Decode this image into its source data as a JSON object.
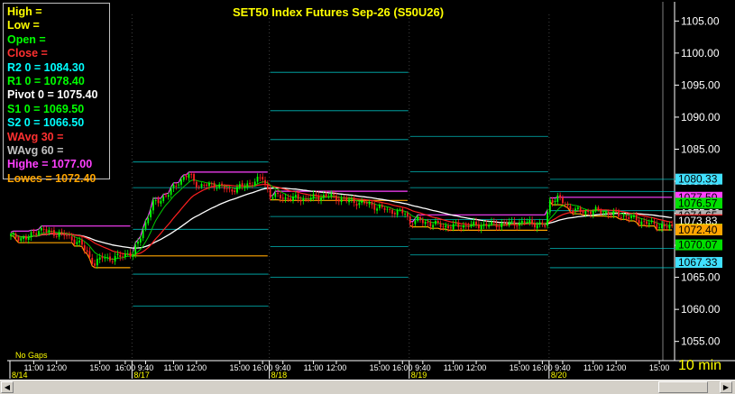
{
  "chart_data": {
    "type": "candlestick",
    "title": "SET50  Index  Futures  Sep-26  (S50U26)",
    "interval_label": "10  min",
    "no_gaps_label": "No  Gaps",
    "ylim": [
      1052,
      1108
    ],
    "y_ticks": [
      {
        "value": 1055,
        "label": "1055.00"
      },
      {
        "value": 1060,
        "label": "1060.00"
      },
      {
        "value": 1065,
        "label": "1065.00"
      },
      {
        "value": 1070,
        "label": "1070.00"
      },
      {
        "value": 1075,
        "label": "1075.00"
      },
      {
        "value": 1080,
        "label": "1080.00"
      },
      {
        "value": 1085,
        "label": "1085.00"
      },
      {
        "value": 1090,
        "label": "1090.00"
      },
      {
        "value": 1095,
        "label": "1095.00"
      },
      {
        "value": 1100,
        "label": "1100.00"
      },
      {
        "value": 1105,
        "label": "1105.00"
      }
    ],
    "x_time_labels": [
      {
        "i": 9,
        "label": "11:00"
      },
      {
        "i": 18,
        "label": "12:00"
      },
      {
        "i": 35,
        "label": "15:00"
      },
      {
        "i": 45,
        "label": "16:00"
      },
      {
        "i": 53,
        "label": "9:40"
      },
      {
        "i": 64,
        "label": "11:00"
      },
      {
        "i": 73,
        "label": "12:00"
      },
      {
        "i": 90,
        "label": "15:00"
      },
      {
        "i": 99,
        "label": "16:00"
      },
      {
        "i": 107,
        "label": "9:40"
      },
      {
        "i": 119,
        "label": "11:00"
      },
      {
        "i": 128,
        "label": "12:00"
      },
      {
        "i": 145,
        "label": "15:00"
      },
      {
        "i": 154,
        "label": "16:00"
      },
      {
        "i": 162,
        "label": "9:40"
      },
      {
        "i": 174,
        "label": "11:00"
      },
      {
        "i": 183,
        "label": "12:00"
      },
      {
        "i": 200,
        "label": "15:00"
      },
      {
        "i": 209,
        "label": "16:00"
      },
      {
        "i": 217,
        "label": "9:40"
      },
      {
        "i": 229,
        "label": "11:00"
      },
      {
        "i": 238,
        "label": "12:00"
      },
      {
        "i": 255,
        "label": "15:00"
      }
    ],
    "x_date_labels": [
      {
        "i": 0,
        "label": "8/14"
      },
      {
        "i": 48,
        "label": "8/17"
      },
      {
        "i": 102,
        "label": "8/18"
      },
      {
        "i": 157,
        "label": "8/19"
      },
      {
        "i": 212,
        "label": "8/20"
      }
    ],
    "day_starts": [
      48,
      102,
      157,
      212
    ],
    "anchors": [
      {
        "i": 0,
        "v": 1071.5
      },
      {
        "i": 6,
        "v": 1071.0
      },
      {
        "i": 11,
        "v": 1072.5
      },
      {
        "i": 16,
        "v": 1072.0
      },
      {
        "i": 22,
        "v": 1071.5
      },
      {
        "i": 28,
        "v": 1070.0
      },
      {
        "i": 33,
        "v": 1067.0
      },
      {
        "i": 36,
        "v": 1068.2
      },
      {
        "i": 40,
        "v": 1067.8
      },
      {
        "i": 46,
        "v": 1068.8
      },
      {
        "i": 48,
        "v": 1068.5
      },
      {
        "i": 52,
        "v": 1072.5
      },
      {
        "i": 56,
        "v": 1076.5
      },
      {
        "i": 62,
        "v": 1078.0
      },
      {
        "i": 66,
        "v": 1080.0
      },
      {
        "i": 70,
        "v": 1081.0
      },
      {
        "i": 74,
        "v": 1079.2
      },
      {
        "i": 80,
        "v": 1079.5
      },
      {
        "i": 86,
        "v": 1078.6
      },
      {
        "i": 92,
        "v": 1079.3
      },
      {
        "i": 99,
        "v": 1080.5
      },
      {
        "i": 102,
        "v": 1077.8
      },
      {
        "i": 108,
        "v": 1077.4
      },
      {
        "i": 116,
        "v": 1077.2
      },
      {
        "i": 124,
        "v": 1077.8
      },
      {
        "i": 132,
        "v": 1077.0
      },
      {
        "i": 140,
        "v": 1076.5
      },
      {
        "i": 148,
        "v": 1075.5
      },
      {
        "i": 155,
        "v": 1075.0
      },
      {
        "i": 157,
        "v": 1073.6
      },
      {
        "i": 160,
        "v": 1073.9
      },
      {
        "i": 165,
        "v": 1073.4
      },
      {
        "i": 172,
        "v": 1072.9
      },
      {
        "i": 180,
        "v": 1073.1
      },
      {
        "i": 188,
        "v": 1073.2
      },
      {
        "i": 196,
        "v": 1073.4
      },
      {
        "i": 204,
        "v": 1073.6
      },
      {
        "i": 210,
        "v": 1073.0
      },
      {
        "i": 212,
        "v": 1077.0
      },
      {
        "i": 215,
        "v": 1077.4
      },
      {
        "i": 219,
        "v": 1076.0
      },
      {
        "i": 224,
        "v": 1075.2
      },
      {
        "i": 230,
        "v": 1075.4
      },
      {
        "i": 236,
        "v": 1075.0
      },
      {
        "i": 242,
        "v": 1074.5
      },
      {
        "i": 250,
        "v": 1073.5
      },
      {
        "i": 256,
        "v": 1073.0
      },
      {
        "i": 260,
        "v": 1072.7
      }
    ],
    "day_high_low": [
      {
        "from": 0,
        "to": 48,
        "high": 1074.0,
        "low": 1066.5
      },
      {
        "from": 48,
        "to": 102,
        "high": 1081.6,
        "low": 1066.5
      },
      {
        "from": 102,
        "to": 157,
        "high": 1081.6,
        "low": 1077.0
      },
      {
        "from": 157,
        "to": 212,
        "high": 1078.2,
        "low": 1071.0
      },
      {
        "from": 212,
        "to": 262,
        "high": 1077.5,
        "low": 1072.4
      }
    ],
    "pivot_segments": [
      {
        "from": 48,
        "to": 102,
        "levels": [
          1083.0,
          1079.0,
          1072.5,
          1065.5,
          1060.5
        ]
      },
      {
        "from": 102,
        "to": 157,
        "levels": [
          1097.0,
          1091.0,
          1086.5,
          1080.0,
          1074.5,
          1069.8,
          1065.0
        ]
      },
      {
        "from": 157,
        "to": 212,
        "levels": [
          1087.0,
          1081.5,
          1079.0,
          1074.0,
          1071.0,
          1068.5
        ]
      },
      {
        "from": 212,
        "to": 262,
        "levels": [
          1080.3,
          1078.4,
          1075.4,
          1069.5,
          1066.5
        ]
      }
    ],
    "legend": [
      {
        "label": "High  =",
        "color": "#ffff00"
      },
      {
        "label": "Low  =",
        "color": "#ffff00"
      },
      {
        "label": "Open  =",
        "color": "#00ff00"
      },
      {
        "label": "Close  =",
        "color": "#ff3030"
      },
      {
        "label": "R2  0   = 1084.30",
        "color": "#00ffff"
      },
      {
        "label": "R1  0   = 1078.40",
        "color": "#00ff00"
      },
      {
        "label": "Pivot  0  = 1075.40",
        "color": "#ffffff"
      },
      {
        "label": "S1  0   = 1069.50",
        "color": "#00ff00"
      },
      {
        "label": "S2  0   = 1066.50",
        "color": "#00ffff"
      },
      {
        "label": "WAvg  30  =",
        "color": "#ff3030"
      },
      {
        "label": "WAvg  60  =",
        "color": "#c0c0c0"
      },
      {
        "label": "Highe = 1077.00",
        "color": "#ff40ff"
      },
      {
        "label": "Lowes  = 1072.40",
        "color": "#ffa500"
      }
    ],
    "price_tags": [
      {
        "value": 1080.33,
        "label": "1080.33",
        "bg": "#40e0ff"
      },
      {
        "value": 1077.5,
        "label": "1077.50",
        "bg": "#ff40ff"
      },
      {
        "value": 1076.57,
        "label": "1076.57",
        "bg": "#00e000"
      },
      {
        "value": 1074.65,
        "label": "1074.65",
        "bg": "#b0b0b0"
      },
      {
        "value": 1073.99,
        "label": "1073.99",
        "bg": "#ff2020"
      },
      {
        "value": 1073.83,
        "label": "1073.83",
        "bg": "#000000",
        "fg": "#ffffff"
      },
      {
        "value": 1072.5,
        "label": "1072.50",
        "bg": "#ffff00"
      },
      {
        "value": 1072.4,
        "label": "1072.40",
        "bg": "#ffa500"
      },
      {
        "value": 1070.07,
        "label": "1070.07",
        "bg": "#00e000"
      },
      {
        "value": 1067.33,
        "label": "1067.33",
        "bg": "#40e0ff"
      }
    ],
    "colors": {
      "background": "#000000",
      "up": "#00ff00",
      "down": "#ff2020",
      "wavg30": "#ff2020",
      "wavg60": "#ffffff",
      "fast_avg": "#00cc00",
      "high": "#ff40ff",
      "low": "#ffa500",
      "pivot_line": "#00cccc",
      "axis_text": "#ffffff",
      "date_text": "#ffff00",
      "grid": "#333333"
    }
  }
}
